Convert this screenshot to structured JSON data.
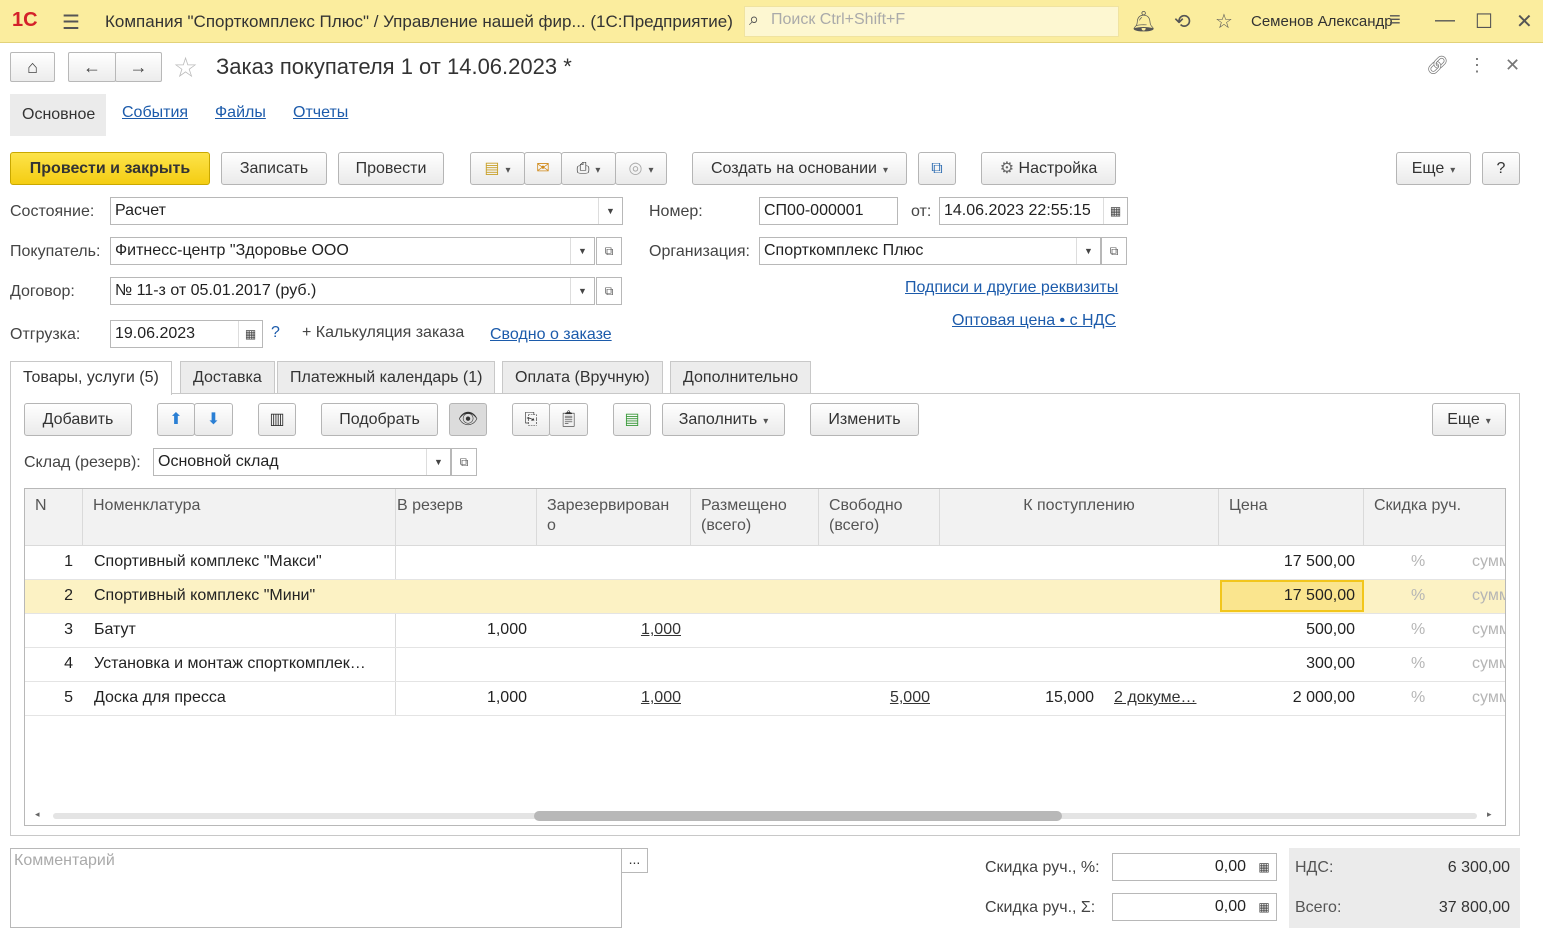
{
  "titlebar": {
    "logo": "1С",
    "title": "Компания \"Спорткомплекс Плюс\" / Управление нашей фир...  (1С:Предприятие)",
    "search_placeholder": "Поиск Ctrl+Shift+F",
    "user": "Семенов Александр"
  },
  "form": {
    "title": "Заказ покупателя 1 от 14.06.2023 *",
    "sections": [
      "Основное",
      "События",
      "Файлы",
      "Отчеты"
    ]
  },
  "toolbar": {
    "post_close": "Провести и закрыть",
    "save": "Записать",
    "post": "Провести",
    "create_based": "Создать на основании",
    "settings": "Настройка",
    "more": "Еще",
    "help": "?"
  },
  "fields": {
    "state_label": "Состояние:",
    "state_value": "Расчет",
    "buyer_label": "Покупатель:",
    "buyer_value": "Фитнесс-центр \"Здоровье ООО",
    "contract_label": "Договор:",
    "contract_value": "№ 11-з от 05.01.2017 (руб.)",
    "shipment_label": "Отгрузка:",
    "shipment_value": "19.06.2023",
    "shipment_help": "?",
    "calc_label": "+ Калькуляция заказа",
    "summary_link": "Сводно о заказе",
    "number_label": "Номер:",
    "number_value": "СП00-000001",
    "from_label": "от:",
    "date_value": "14.06.2023 22:55:15",
    "org_label": "Организация:",
    "org_value": "Спорткомплекс Плюс",
    "signatures_link": "Подписи и другие реквизиты",
    "price_link": "Оптовая цена • с НДС"
  },
  "tabs": [
    "Товары, услуги (5)",
    "Доставка",
    "Платежный календарь (1)",
    "Оплата (Вручную)",
    "Дополнительно"
  ],
  "table_toolbar": {
    "add": "Добавить",
    "pick": "Подобрать",
    "fill": "Заполнить",
    "change": "Изменить",
    "more": "Еще",
    "warehouse_label": "Склад (резерв):",
    "warehouse_value": "Основной склад"
  },
  "table": {
    "headers": {
      "n": "N",
      "item": "Номенклатура",
      "reserve": "В резерв",
      "reserved": "Зарезервирован\nо",
      "placed": "Размещено\n(всего)",
      "free": "Свободно\n(всего)",
      "incoming": "К поступлению",
      "price": "Цена",
      "discount": "Скидка руч."
    },
    "rows": [
      {
        "n": "1",
        "item": "Спортивный комплекс \"Макси\"",
        "reserve": "",
        "reserved": "",
        "free": "",
        "incoming_qty": "",
        "incoming_docs": "",
        "price": "17 500,00",
        "pct": "%",
        "sum": "сумм"
      },
      {
        "n": "2",
        "item": "Спортивный комплекс \"Мини\"",
        "reserve": "",
        "reserved": "",
        "free": "",
        "incoming_qty": "",
        "incoming_docs": "",
        "price": "17 500,00",
        "pct": "%",
        "sum": "сумм"
      },
      {
        "n": "3",
        "item": "Батут",
        "reserve": "1,000",
        "reserved": "1,000",
        "free": "",
        "incoming_qty": "",
        "incoming_docs": "",
        "price": "500,00",
        "pct": "%",
        "sum": "сумм"
      },
      {
        "n": "4",
        "item": "Установка и монтаж спорткомплек…",
        "reserve": "",
        "reserved": "",
        "free": "",
        "incoming_qty": "",
        "incoming_docs": "",
        "price": "300,00",
        "pct": "%",
        "sum": "сумм"
      },
      {
        "n": "5",
        "item": "Доска для пресса",
        "reserve": "1,000",
        "reserved": "1,000",
        "free": "5,000",
        "incoming_qty": "15,000",
        "incoming_docs": "2 докуме…",
        "price": "2 000,00",
        "pct": "%",
        "sum": "сумм"
      }
    ]
  },
  "footer": {
    "comment_placeholder": "Комментарий",
    "comment_btn": "...",
    "disc_pct_label": "Скидка руч., %:",
    "disc_pct_value": "0,00",
    "disc_sum_label": "Скидка руч., Σ:",
    "disc_sum_value": "0,00",
    "vat_label": "НДС:",
    "vat_value": "6 300,00",
    "total_label": "Всего:",
    "total_value": "37 800,00"
  }
}
